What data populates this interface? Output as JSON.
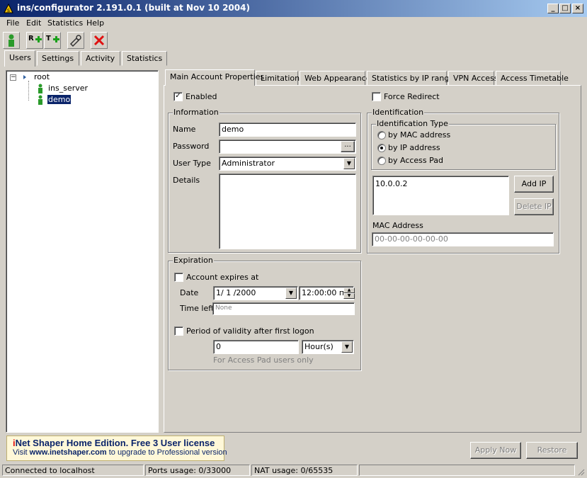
{
  "window": {
    "title": "ins/configurator 2.191.0.1 (built at Nov 10 2004)"
  },
  "menu": [
    "File",
    "Edit",
    "Statistics",
    "Help"
  ],
  "left_tabs": [
    "Users",
    "Settings",
    "Activity",
    "Statistics"
  ],
  "tree": {
    "root": "root",
    "children": [
      "ins_server",
      "demo"
    ]
  },
  "right_tabs": [
    "Main Account Properties",
    "Limitations",
    "Web Appearance",
    "Statistics by IP range",
    "VPN Access",
    "Access Timetable"
  ],
  "main": {
    "enabled_label": "Enabled",
    "force_redirect_label": "Force Redirect",
    "information": {
      "group_label": "Information",
      "name_label": "Name",
      "name_value": "demo",
      "password_label": "Password",
      "password_value": "",
      "browse_label": "...",
      "user_type_label": "User Type",
      "user_type_value": "Administrator",
      "details_label": "Details",
      "details_value": ""
    },
    "expiration": {
      "group_label": "Expiration",
      "account_expires_label": "Account expires at",
      "date_label": "Date",
      "date_value": "1/ 1 /2000",
      "time_value": "12:00:00 пп",
      "time_left_label": "Time left",
      "time_left_value": "None",
      "period_label": "Period of validity after first logon",
      "period_value": "0",
      "period_unit": "Hour(s)",
      "note": "For Access Pad users only"
    },
    "identification": {
      "group_label": "Identification",
      "type_label": "Identification Type",
      "options": [
        "by MAC address",
        "by IP address",
        "by Access Pad"
      ],
      "ip_list": [
        "10.0.0.2"
      ],
      "add_ip": "Add IP",
      "delete_ip": "Delete IP",
      "mac_label": "MAC Address",
      "mac_placeholder": "00-00-00-00-00-00"
    }
  },
  "banner": {
    "line1_prefix": "i",
    "line1_rest": "Net Shaper Home Edition. Free 3 User license",
    "line2_prefix": "Visit ",
    "line2_link": "www.inetshaper.com",
    "line2_rest": " to upgrade to Professional version"
  },
  "buttons": {
    "apply": "Apply Now",
    "restore": "Restore"
  },
  "statusbar": [
    "Connected  to localhost",
    "Ports usage: 0/33000",
    "NAT usage: 0/65535",
    ""
  ]
}
